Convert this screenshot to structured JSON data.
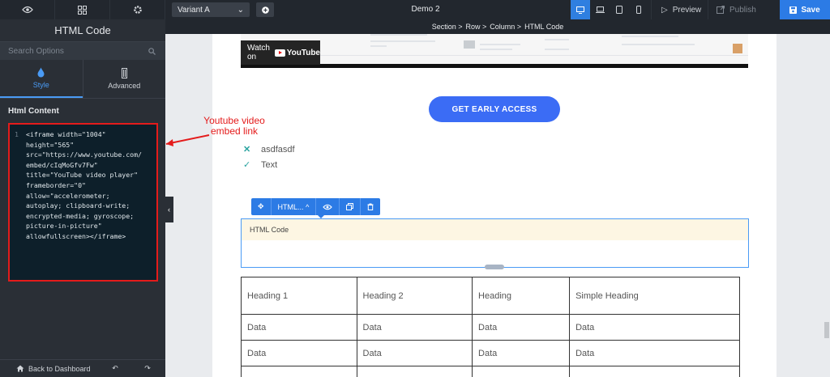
{
  "topbar": {
    "variant": "Variant A",
    "title": "Demo 2",
    "preview_label": "Preview",
    "publish_label": "Publish",
    "save_label": "Save"
  },
  "sidebar": {
    "title": "HTML Code",
    "search_placeholder": "Search Options",
    "tabs": [
      {
        "label": "Style"
      },
      {
        "label": "Advanced"
      }
    ],
    "section_label": "Html Content",
    "code_line_number": "1",
    "code": "<iframe width=\"1004\"\nheight=\"565\"\nsrc=\"https://www.youtube.com/\nembed/cIqMoGfv7Fw\"\ntitle=\"YouTube video player\"\nframeborder=\"0\"\nallow=\"accelerometer;\nautoplay; clipboard-write;\nencrypted-media; gyroscope;\npicture-in-picture\"\nallowfullscreen></iframe>",
    "back_label": "Back to Dashboard"
  },
  "breadcrumb": [
    "Section >",
    "Row >",
    "Column >",
    "HTML Code"
  ],
  "annotation": {
    "line1": "Youtube video",
    "line2": "embed link",
    "color": "#e41b1b"
  },
  "canvas": {
    "watch_on": "Watch on",
    "youtube": "YouTube",
    "cta_label": "GET EARLY ACCESS",
    "list_items": [
      {
        "icon": "x-icon",
        "text": "asdfasdf"
      },
      {
        "icon": "check-icon",
        "text": "Text"
      }
    ],
    "toolbar_label": "HTML...",
    "html_block_label": "HTML Code",
    "table": {
      "headers": [
        "Heading 1",
        "Heading 2",
        "Heading",
        "Simple Heading"
      ],
      "rows": [
        [
          "Data",
          "Data",
          "Data",
          "Data"
        ],
        [
          "Data",
          "Data",
          "Data",
          "Data"
        ],
        [
          "",
          "",
          "",
          ""
        ]
      ]
    }
  },
  "colors": {
    "accent": "#2c7be5",
    "cta": "#3b6cf5",
    "sidebar_bg": "#2a2f36",
    "topbar_bg": "#22272e"
  }
}
